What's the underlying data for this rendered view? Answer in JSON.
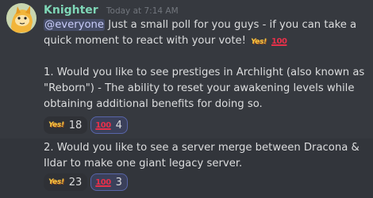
{
  "message": {
    "username": "Knighter",
    "timestamp": "Today at 7:14 AM",
    "mention": "@everyone",
    "intro_text": "Just a small poll for you guys - if you can take a quick moment to react with your vote!",
    "intro_emojis": [
      "yes-emoji",
      "100-emoji"
    ],
    "question1": "1. Would you like to see prestiges in Archlight (also known as \"Reborn\") - The ability to reset your awakening levels while obtaining additional benefits for doing so.",
    "question2": "2. Would you like to see a server merge between Dracona & Ildar to make one giant legacy server."
  },
  "reactions_q1": [
    {
      "emoji": "yes-emoji",
      "emoji_text": "Yes!",
      "count": "18",
      "selected": false
    },
    {
      "emoji": "100-emoji",
      "emoji_text": "100",
      "count": "4",
      "selected": true
    }
  ],
  "reactions_q2": [
    {
      "emoji": "yes-emoji",
      "emoji_text": "Yes!",
      "count": "23",
      "selected": false
    },
    {
      "emoji": "100-emoji",
      "emoji_text": "100",
      "count": "3",
      "selected": true
    }
  ],
  "colors": {
    "background": "#36393f",
    "hover_background": "#32353b",
    "username": "#7ed6b6",
    "mention_bg": "#414675",
    "reaction_selected_border": "#5865a8"
  }
}
